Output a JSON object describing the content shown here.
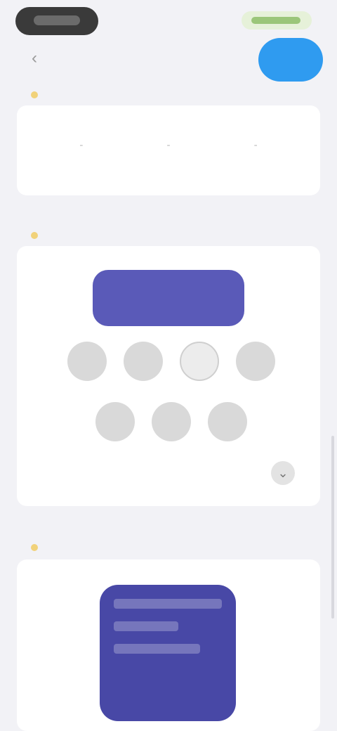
{
  "header": {
    "title": "",
    "primary_button": ""
  },
  "time_section": {
    "label": "",
    "range": [
      "",
      "",
      "",
      ""
    ],
    "note": ""
  },
  "days_section": {
    "label": "",
    "banner": "",
    "days": [
      {
        "label": "",
        "caption": "",
        "on": true
      },
      {
        "label": "",
        "caption": "",
        "on": true
      },
      {
        "label": "",
        "caption": "",
        "on": false
      },
      {
        "label": "",
        "caption": "",
        "on": true
      },
      {
        "label": "",
        "caption": "",
        "on": true
      },
      {
        "label": "",
        "caption": "",
        "on": true
      },
      {
        "label": "",
        "caption": "",
        "on": true
      }
    ],
    "repeat_text": ""
  },
  "color_section": {
    "label": "",
    "tile_text": ""
  },
  "colors": {
    "primary_button": "#2f9bf0",
    "banner": "#5a5ab8",
    "tile": "#4848a6",
    "background": "#f2f2f6"
  },
  "icons": {
    "back": "chevron-left-icon",
    "more": "chevron-down-icon",
    "warning": "warning-dot-icon"
  }
}
